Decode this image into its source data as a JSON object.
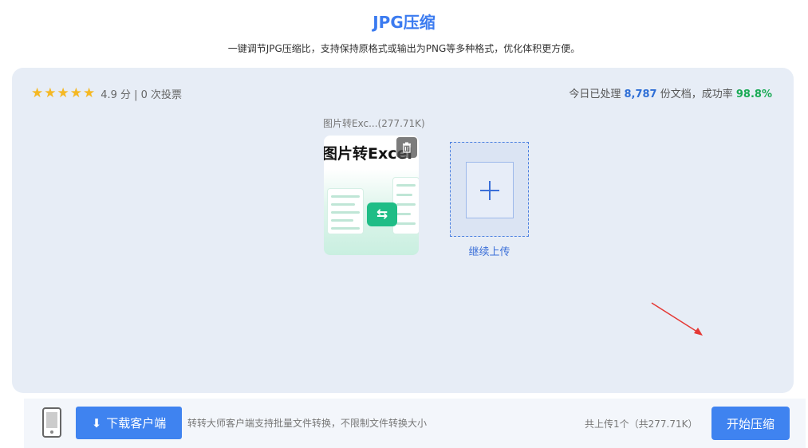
{
  "header": {
    "title": "JPG压缩",
    "subtitle": "一键调节JPG压缩比，支持保持原格式或输出为PNG等多种格式，优化体积更方便。"
  },
  "rating": {
    "stars": "★★★★★",
    "text": "4.9 分 | 0 次投票"
  },
  "stats": {
    "prefix": "今日已处理",
    "count": "8,787",
    "middle": "份文档，成功率",
    "rate": "98.8%"
  },
  "file": {
    "name": "图片转Exc...(277.71K)",
    "thumb_text": "图片转Excel",
    "delete_icon": "trash-icon",
    "swap_icon": "⇆"
  },
  "upload": {
    "plus": "+",
    "label": "继续上传"
  },
  "footer": {
    "download_label": "下载客户端",
    "download_icon": "⬇",
    "description": "转转大师客户端支持批量文件转换，不限制文件转换大小",
    "summary": "共上传1个（共277.71K）",
    "start_label": "开始压缩"
  },
  "colors": {
    "accent": "#3f83f0",
    "success": "#1aaa55",
    "annotation": "#e53935"
  }
}
